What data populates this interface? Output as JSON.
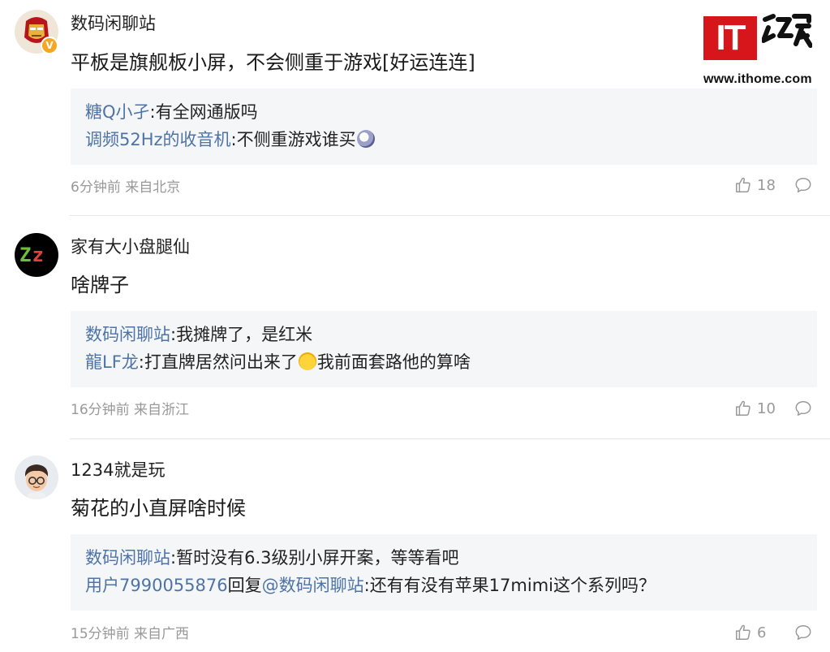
{
  "watermark": {
    "logo_text": "IT",
    "logo_glyph": "之家",
    "url": "www.ithome.com"
  },
  "comments": [
    {
      "username": "数码闲聊站",
      "avatar": "ironman-avatar",
      "verified_badge": "V",
      "content": "平板是旗舰板小屏，不会侧重于游戏[好运连连]",
      "replies": [
        {
          "user": "糖Q小孑",
          "sep": ":",
          "text": "有全网通版吗"
        },
        {
          "user": "调频52Hz的收音机",
          "sep": ":",
          "text": "不侧重游戏谁买",
          "emoji": "dizzy-face-emoji"
        }
      ],
      "time": "6分钟前",
      "location": "来自北京",
      "likes": "18"
    },
    {
      "username": "家有大小盘腿仙",
      "avatar": "zz-avatar",
      "avatar_text": "Zz",
      "content": "啥牌子",
      "replies": [
        {
          "user": "数码闲聊站",
          "sep": ":",
          "text": "我摊牌了，是红米"
        },
        {
          "user": "龍LF龙",
          "sep": ":",
          "text_before": "打直牌居然问出来了",
          "emoji": "laughing-tears-emoji",
          "text": "我前面套路他的算啥"
        }
      ],
      "time": "16分钟前",
      "location": "来自浙江",
      "likes": "10"
    },
    {
      "username": "1234就是玩",
      "avatar": "cartoon-boy-avatar",
      "content": "菊花的小直屏啥时候",
      "replies": [
        {
          "user": "数码闲聊站",
          "sep": ":",
          "text": "暂时没有6.3级别小屏开案，等等看吧"
        },
        {
          "user": "用户7990055876",
          "mid": "回复",
          "user2": "@数码闲聊站",
          "sep": ":",
          "text": "还有有没有苹果17mimi这个系列吗？"
        }
      ],
      "time": "15分钟前",
      "location": "来自广西",
      "likes": "6"
    }
  ],
  "colors": {
    "reply_user": "#4e74a7",
    "meta": "#999999",
    "reply_bg": "#f5f6f8",
    "logo_red": "#d7161c"
  },
  "icons": {
    "like": "thumbs-up-icon",
    "comment": "speech-bubble-icon"
  }
}
